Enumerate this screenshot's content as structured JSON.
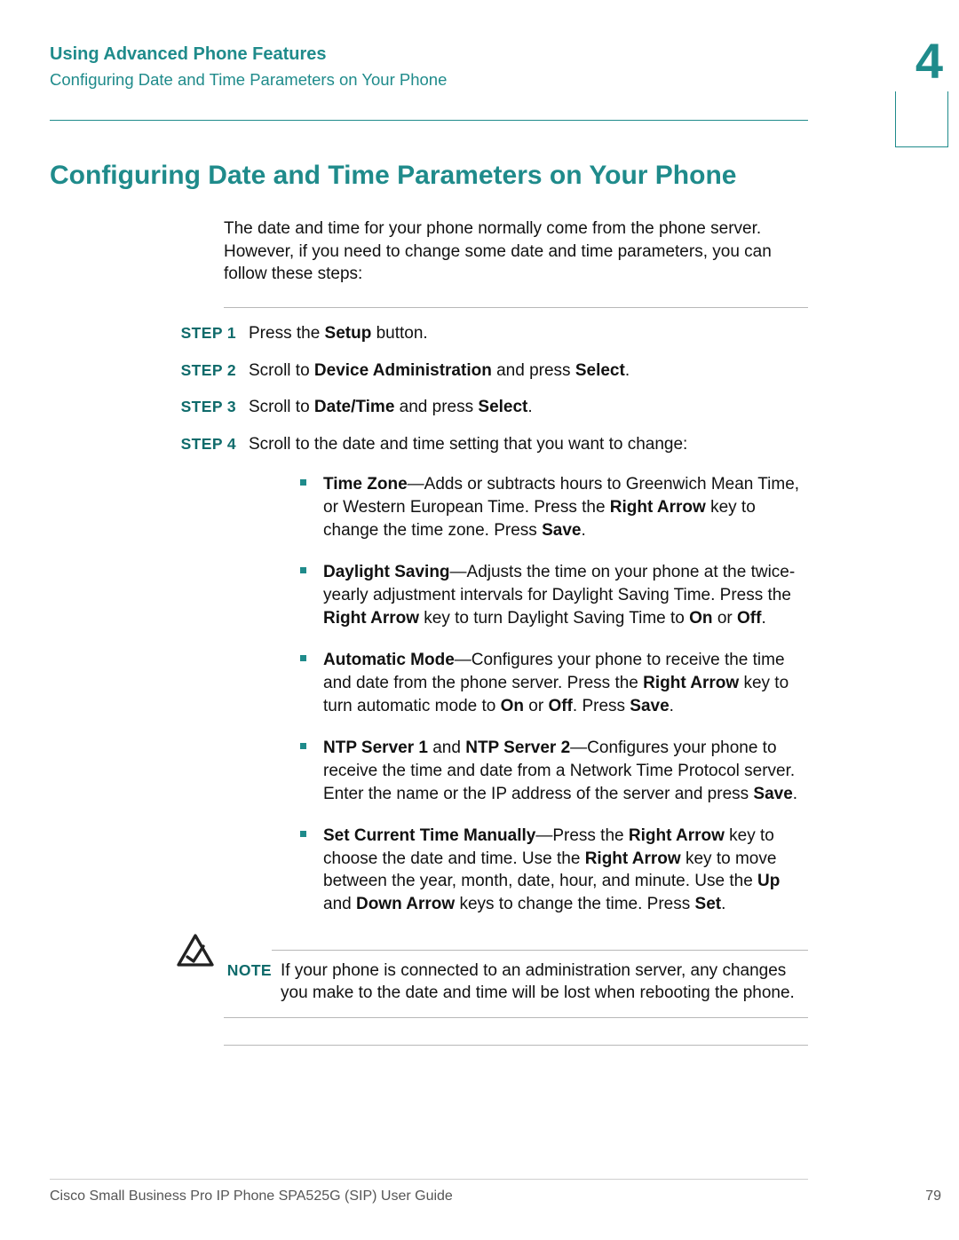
{
  "header": {
    "chapter_title": "Using Advanced Phone Features",
    "breadcrumb": "Configuring Date and Time Parameters on Your Phone",
    "chapter_number": "4"
  },
  "title": "Configuring Date and Time Parameters on Your Phone",
  "intro": "The date and time for your phone normally come from the phone server. However, if you need to change some date and time parameters, you can follow these steps:",
  "steps": {
    "s1_label": "STEP 1",
    "s1_pre": "Press the ",
    "s1_b1": "Setup",
    "s1_post": " button.",
    "s2_label": "STEP 2",
    "s2_pre": "Scroll to ",
    "s2_b1": "Device Administration",
    "s2_mid": " and press ",
    "s2_b2": "Select",
    "s2_post": ".",
    "s3_label": "STEP 3",
    "s3_pre": "Scroll to ",
    "s3_b1": "Date/Time",
    "s3_mid": " and press ",
    "s3_b2": "Select",
    "s3_post": ".",
    "s4_label": "STEP 4",
    "s4_text": "Scroll to the date and time setting that you want to change:"
  },
  "bullets": {
    "b1_t1": "Time Zone",
    "b1_t2": "—Adds or subtracts hours to Greenwich Mean Time, or Western European Time. Press the ",
    "b1_t3": "Right Arrow",
    "b1_t4": " key to change the time zone. Press ",
    "b1_t5": "Save",
    "b1_t6": ".",
    "b2_t1": "Daylight Saving",
    "b2_t2": "—Adjusts the time on your phone at the twice-yearly adjustment intervals for Daylight Saving Time. Press the ",
    "b2_t3": "Right Arrow",
    "b2_t4": " key to turn Daylight Saving Time to ",
    "b2_t5": "On",
    "b2_t6": " or ",
    "b2_t7": "Off",
    "b2_t8": ".",
    "b3_t1": "Automatic Mode",
    "b3_t2": "—Configures your phone to receive the time and date from the phone server. Press the ",
    "b3_t3": "Right Arrow",
    "b3_t4": " key to turn automatic mode to ",
    "b3_t5": "On",
    "b3_t6": " or ",
    "b3_t7": "Off",
    "b3_t8": ". Press ",
    "b3_t9": "Save",
    "b3_t10": ".",
    "b4_t1": "NTP Server 1",
    "b4_t2": " and ",
    "b4_t3": "NTP Server 2",
    "b4_t4": "—Configures your phone to receive the time and date from a Network Time Protocol server. Enter the name or the IP address of the server and press ",
    "b4_t5": "Save",
    "b4_t6": ".",
    "b5_t1": "Set Current Time Manually",
    "b5_t2": "—Press the ",
    "b5_t3": "Right Arrow",
    "b5_t4": " key to choose the date and time. Use the ",
    "b5_t5": "Right Arrow",
    "b5_t6": " key to move between the year, month, date, hour, and minute. Use the ",
    "b5_t7": "Up",
    "b5_t8": " and ",
    "b5_t9": "Down Arrow",
    "b5_t10": " keys to change the time. Press ",
    "b5_t11": "Set",
    "b5_t12": "."
  },
  "note": {
    "label": "NOTE",
    "text": "If your phone is connected to an administration server, any changes you make to the date and time will be lost when rebooting the phone."
  },
  "footer": {
    "book": "Cisco Small Business Pro IP Phone SPA525G (SIP) User Guide",
    "page": "79"
  }
}
